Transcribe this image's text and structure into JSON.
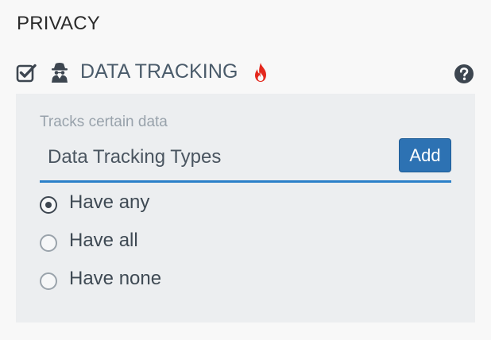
{
  "section": {
    "title": "PRIVACY"
  },
  "feature": {
    "label": "DATA TRACKING",
    "checked": true,
    "icons": {
      "checkbox": "checked-checkbox-icon",
      "feature": "spy-icon",
      "hot": "fire-icon",
      "help": "question-circle-icon"
    },
    "colors": {
      "label": "#4a5b6a",
      "fire": "#e4281d"
    }
  },
  "panel": {
    "description": "Tracks certain data",
    "input": {
      "placeholder": "Data Tracking Types",
      "value": ""
    },
    "add_label": "Add",
    "options": [
      {
        "label": "Have any",
        "selected": true
      },
      {
        "label": "Have all",
        "selected": false
      },
      {
        "label": "Have none",
        "selected": false
      }
    ],
    "colors": {
      "accent": "#2b80c9",
      "button": "#2d72b3",
      "background": "#eceef0"
    }
  }
}
